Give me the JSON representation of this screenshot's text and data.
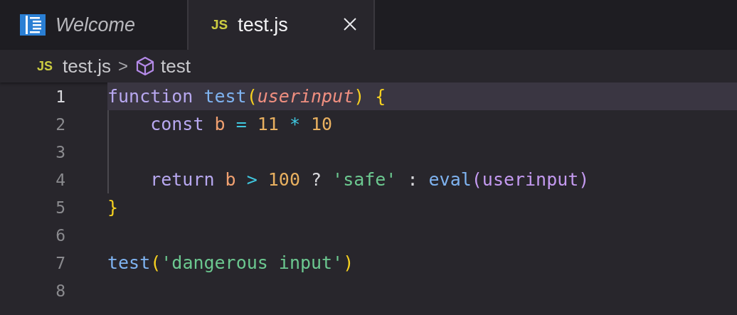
{
  "tabs": [
    {
      "label": "Welcome",
      "kind": "welcome",
      "selected": false
    },
    {
      "label": "test.js",
      "kind": "js",
      "icon_text": "JS",
      "selected": true
    }
  ],
  "breadcrumb": [
    {
      "label": "test.js",
      "kind": "file",
      "icon_text": "JS"
    },
    {
      "label": "test",
      "kind": "symbol"
    }
  ],
  "breadcrumb_separator": ">",
  "lines": [
    {
      "number": "1",
      "current": true,
      "guide": false,
      "indent": false,
      "words": [
        [
          {
            "text": "function",
            "kind": "keyword"
          }
        ],
        [
          {
            "text": "test",
            "kind": "function"
          },
          {
            "text": "(",
            "kind": "bracket"
          },
          {
            "text": "userinput",
            "kind": "param"
          },
          {
            "text": ")",
            "kind": "bracket"
          }
        ],
        [
          {
            "text": "{",
            "kind": "bracket"
          }
        ]
      ]
    },
    {
      "number": "2",
      "current": false,
      "guide": true,
      "indent": true,
      "words": [
        [
          {
            "text": "const",
            "kind": "keyword"
          }
        ],
        [
          {
            "text": "b",
            "kind": "variable"
          }
        ],
        [
          {
            "text": "=",
            "kind": "operator"
          }
        ],
        [
          {
            "text": "11",
            "kind": "number"
          }
        ],
        [
          {
            "text": "*",
            "kind": "operator"
          }
        ],
        [
          {
            "text": "10",
            "kind": "number"
          }
        ]
      ]
    },
    {
      "number": "3",
      "current": false,
      "guide": true
    },
    {
      "number": "4",
      "current": false,
      "guide": true,
      "indent": true,
      "words": [
        [
          {
            "text": "return",
            "kind": "keyword"
          }
        ],
        [
          {
            "text": "b",
            "kind": "variable"
          }
        ],
        [
          {
            "text": ">",
            "kind": "operator"
          }
        ],
        [
          {
            "text": "100",
            "kind": "number"
          }
        ],
        [
          {
            "text": "?",
            "kind": "plain"
          }
        ],
        [
          {
            "text": "'safe'",
            "kind": "string"
          }
        ],
        [
          {
            "text": ":",
            "kind": "plain"
          }
        ],
        [
          {
            "text": "eval",
            "kind": "function"
          },
          {
            "text": "(",
            "kind": "bracket2"
          },
          {
            "text": "userinput",
            "kind": "ident"
          },
          {
            "text": ")",
            "kind": "bracket2"
          }
        ]
      ]
    },
    {
      "number": "5",
      "current": false,
      "guide": false,
      "indent": false,
      "words": [
        [
          {
            "text": "}",
            "kind": "bracket"
          }
        ]
      ]
    },
    {
      "number": "6",
      "current": false,
      "guide": false
    },
    {
      "number": "7",
      "current": false,
      "guide": false,
      "indent": false,
      "words": [
        [
          {
            "text": "test",
            "kind": "function"
          },
          {
            "text": "(",
            "kind": "bracket"
          },
          {
            "text": "'dangerous input'",
            "kind": "string"
          },
          {
            "text": ")",
            "kind": "bracket"
          }
        ]
      ]
    },
    {
      "number": "8",
      "current": false,
      "guide": false
    }
  ]
}
